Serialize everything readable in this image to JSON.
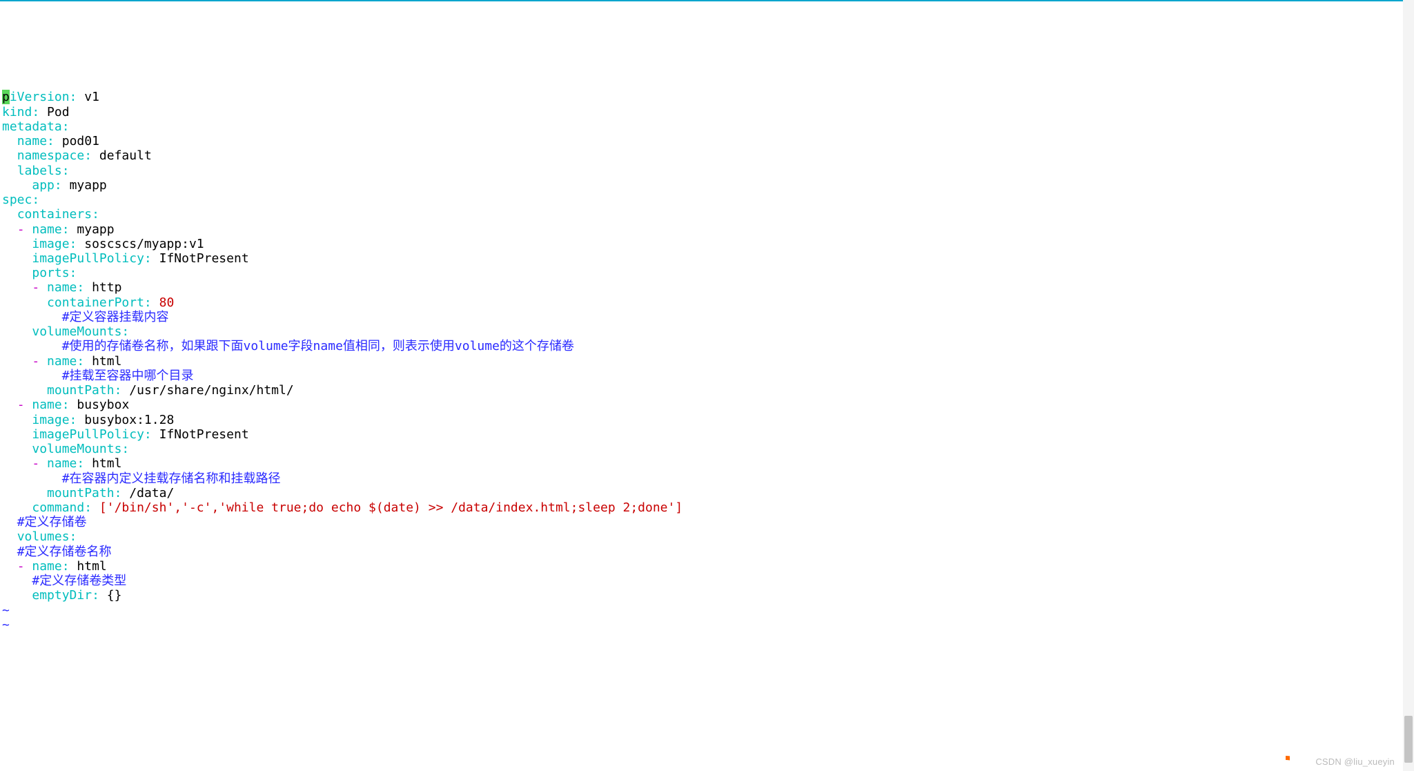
{
  "file_type": "editor-yaml",
  "cursor_char": "p",
  "watermark": "CSDN @liu_xueyin",
  "yaml": {
    "apiVersion_key_part": "iVersion",
    "apiVersion_value": "v1",
    "kind_key": "kind",
    "kind_value": "Pod",
    "metadata_key": "metadata",
    "metadata": {
      "name_key": "name",
      "name_value": "pod01",
      "namespace_key": "namespace",
      "namespace_value": "default",
      "labels_key": "labels",
      "labels": {
        "app_key": "app",
        "app_value": "myapp"
      }
    },
    "spec_key": "spec",
    "spec": {
      "containers_key": "containers",
      "containers": [
        {
          "name_key": "name",
          "name_value": "myapp",
          "image_key": "image",
          "image_value": "soscscs/myapp:v1",
          "imagePullPolicy_key": "imagePullPolicy",
          "imagePullPolicy_value": "IfNotPresent",
          "ports_key": "ports",
          "ports": [
            {
              "name_key": "name",
              "name_value": "http",
              "containerPort_key": "containerPort",
              "containerPort_value": "80",
              "comment_define_mount": "#定义容器挂载内容"
            }
          ],
          "volumeMounts_key": "volumeMounts",
          "vm_comment_usage": "#使用的存储卷名称，如果跟下面volume字段name值相同，则表示使用volume的这个存储卷",
          "volumeMounts": [
            {
              "name_key": "name",
              "name_value": "html",
              "comment_mount_dir": "#挂载至容器中哪个目录",
              "mountPath_key": "mountPath",
              "mountPath_value": "/usr/share/nginx/html/"
            }
          ]
        },
        {
          "name_key": "name",
          "name_value": "busybox",
          "image_key": "image",
          "image_value": "busybox:1.28",
          "imagePullPolicy_key": "imagePullPolicy",
          "imagePullPolicy_value": "IfNotPresent",
          "volumeMounts_key": "volumeMounts",
          "volumeMounts": [
            {
              "name_key": "name",
              "name_value": "html",
              "comment_define_inside": "#在容器内定义挂载存储名称和挂载路径",
              "mountPath_key": "mountPath",
              "mountPath_value": "/data/"
            }
          ],
          "command_key": "command",
          "command_value": "['/bin/sh','-c','while true;do echo $(date) >> /data/index.html;sleep 2;done']"
        }
      ],
      "comment_define_volume": "#定义存储卷",
      "volumes_key": "volumes",
      "comment_define_volume_name": "#定义存储卷名称",
      "volumes": [
        {
          "name_key": "name",
          "name_value": "html",
          "comment_define_volume_type": "#定义存储卷类型",
          "emptyDir_key": "emptyDir",
          "emptyDir_value": "{}"
        }
      ]
    }
  },
  "tildes": [
    "~",
    "~"
  ]
}
